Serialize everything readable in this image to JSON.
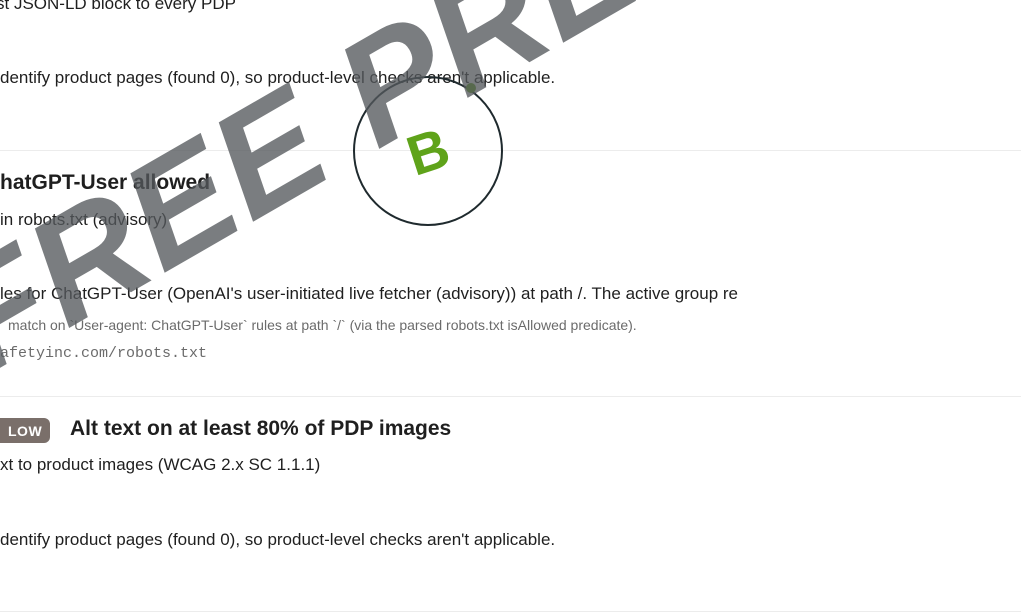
{
  "sections": {
    "top": {
      "title_partial": "st JSON-LD block to every PDP",
      "message": "dentify product pages (found 0), so product-level checks aren't applicable."
    },
    "chatgpt": {
      "title": "hatGPT-User allowed",
      "subtitle": "in robots.txt (advisory)",
      "message": "les for ChatGPT-User (OpenAI's user-initiated live fetcher (advisory)) at path /. The active group re",
      "evidence": "match on `User-agent: ChatGPT-User` rules at path `/` (via the parsed robots.txt isAllowed predicate).",
      "source": "afetyinc.com/robots.txt"
    },
    "alttext": {
      "badge": "LOW",
      "title": "Alt text on at least 80% of PDP images",
      "subtitle": "xt to product images (WCAG 2.x SC 1.1.1)",
      "message": "dentify product pages (found 0), so product-level checks aren't applicable."
    }
  },
  "grade": {
    "letter": "B",
    "color": "#5fa31a"
  },
  "watermark": {
    "text": "FREE PREVIEW"
  }
}
